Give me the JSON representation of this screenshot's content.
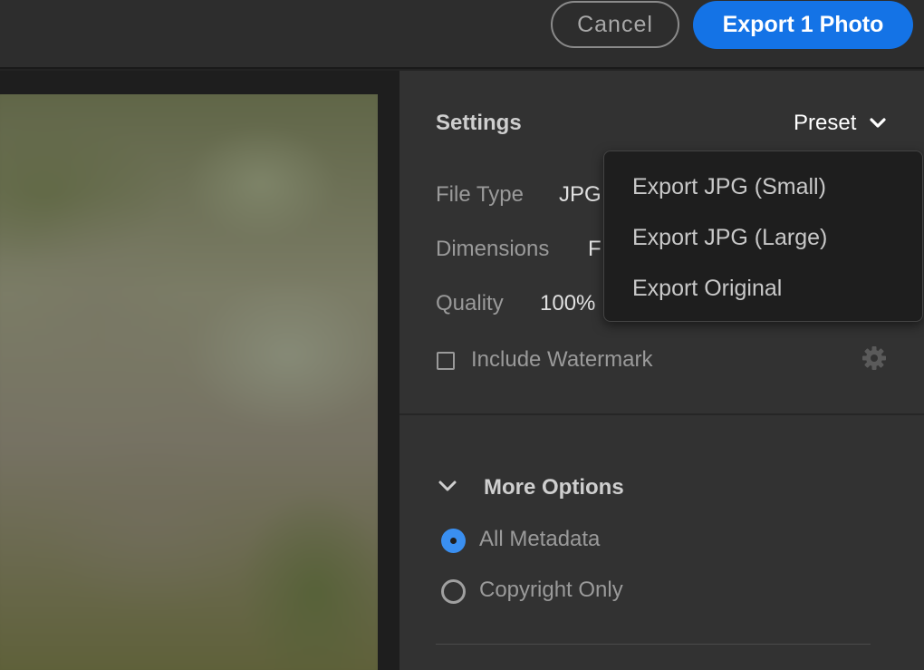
{
  "header": {
    "cancel_label": "Cancel",
    "export_label": "Export 1 Photo"
  },
  "settings": {
    "title": "Settings",
    "preset_label": "Preset",
    "file_type_label": "File Type",
    "file_type_value": "JPG",
    "dimensions_label": "Dimensions",
    "dimensions_value": "F",
    "quality_label": "Quality",
    "quality_value": "100%",
    "watermark_label": "Include Watermark",
    "watermark_checked": false
  },
  "preset_menu": {
    "items": [
      {
        "label": "Export JPG (Small)"
      },
      {
        "label": "Export JPG (Large)"
      },
      {
        "label": "Export Original"
      }
    ]
  },
  "more_options": {
    "title": "More Options",
    "metadata_options": [
      {
        "label": "All Metadata",
        "selected": true
      },
      {
        "label": "Copyright Only",
        "selected": false
      }
    ]
  },
  "colors": {
    "accent": "#1473e6",
    "radio_selected": "#3a8ff0",
    "panel_bg": "#323232"
  },
  "icons": {
    "preset_chevron": "chevron-down-icon",
    "gear": "gear-icon",
    "more_chevron": "chevron-down-icon"
  }
}
